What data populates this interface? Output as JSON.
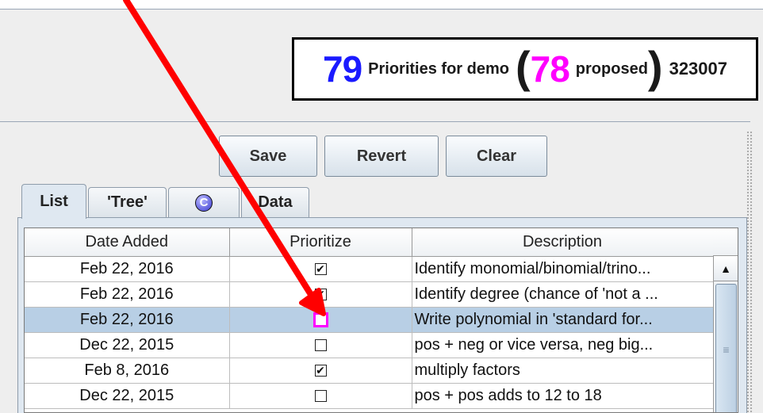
{
  "summary": {
    "total_count": "79",
    "total_label": "Priorities for demo",
    "open_paren": "(",
    "proposed_count": "78",
    "proposed_label": "proposed",
    "close_paren": ")",
    "id_number": "323007"
  },
  "toolbar": {
    "save_label": "Save",
    "revert_label": "Revert",
    "clear_label": "Clear"
  },
  "tabs": {
    "list": "List",
    "tree": "'Tree'",
    "c_icon_letter": "C",
    "data": "Data"
  },
  "table": {
    "headers": {
      "date_added": "Date Added",
      "prioritize": "Prioritize",
      "description": "Description"
    },
    "rows": [
      {
        "date": "Feb 22, 2016",
        "prioritized": true,
        "check": "✔",
        "description": "Identify monomial/binomial/trino..."
      },
      {
        "date": "Feb 22, 2016",
        "prioritized": true,
        "check": "✔",
        "description": "Identify degree (chance of 'not a ..."
      },
      {
        "date": "Feb 22, 2016",
        "prioritized": false,
        "check": "",
        "description": "Write polynomial in 'standard for..."
      },
      {
        "date": "Dec 22, 2015",
        "prioritized": false,
        "check": "",
        "description": "pos + neg or vice versa, neg big..."
      },
      {
        "date": "Feb 8, 2016",
        "prioritized": true,
        "check": "✔",
        "description": "multiply factors"
      },
      {
        "date": "Dec 22, 2015",
        "prioritized": false,
        "check": "",
        "description": "pos + pos adds to 12 to 18"
      }
    ]
  },
  "icons": {
    "scroll_up": "▲",
    "scroll_grip": "≡"
  },
  "colors": {
    "total_count": "#1a1aff",
    "proposed_count": "#ff00ff",
    "selected_row": "#b8cfe5",
    "annotation_arrow": "#ff0000",
    "focus_checkbox": "#ff00ff"
  }
}
